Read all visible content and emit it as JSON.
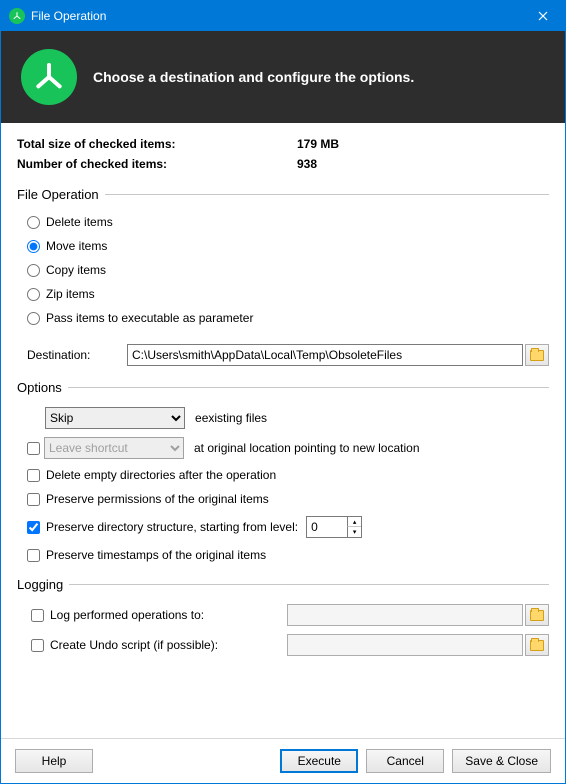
{
  "titlebar": {
    "title": "File Operation"
  },
  "banner": {
    "headline": "Choose a destination and configure the options."
  },
  "stats": {
    "size_label": "Total size of checked items:",
    "size_value": "179 MB",
    "count_label": "Number of checked items:",
    "count_value": "938"
  },
  "file_op": {
    "header": "File Operation",
    "delete": "Delete items",
    "move": "Move items",
    "copy": "Copy items",
    "zip": "Zip items",
    "pass": "Pass items to executable as parameter",
    "selected": "move",
    "dest_label": "Destination:",
    "dest_value": "C:\\Users\\smith\\AppData\\Local\\Temp\\ObsoleteFiles"
  },
  "options": {
    "header": "Options",
    "existing_select": "Skip",
    "existing_after": "existing files",
    "shortcut_select": "Leave shortcut",
    "shortcut_after_pre": "at ",
    "shortcut_after_u": "o",
    "shortcut_after_post": "riginal location pointing to new location",
    "delete_empty": "Delete empty directories after the operation",
    "preserve_perm": "Preserve permissions of the original items",
    "preserve_struct": "Preserve directory structure, starting from level:",
    "level": "0",
    "preserve_ts": "Preserve timestamps of the original items"
  },
  "logging": {
    "header": "Logging",
    "log_ops": "Log performed operations to:",
    "undo": "Create Undo script (if possible):"
  },
  "footer": {
    "help": "Help",
    "execute": "Execute",
    "cancel": "Cancel",
    "save_close": "Save & Close"
  }
}
